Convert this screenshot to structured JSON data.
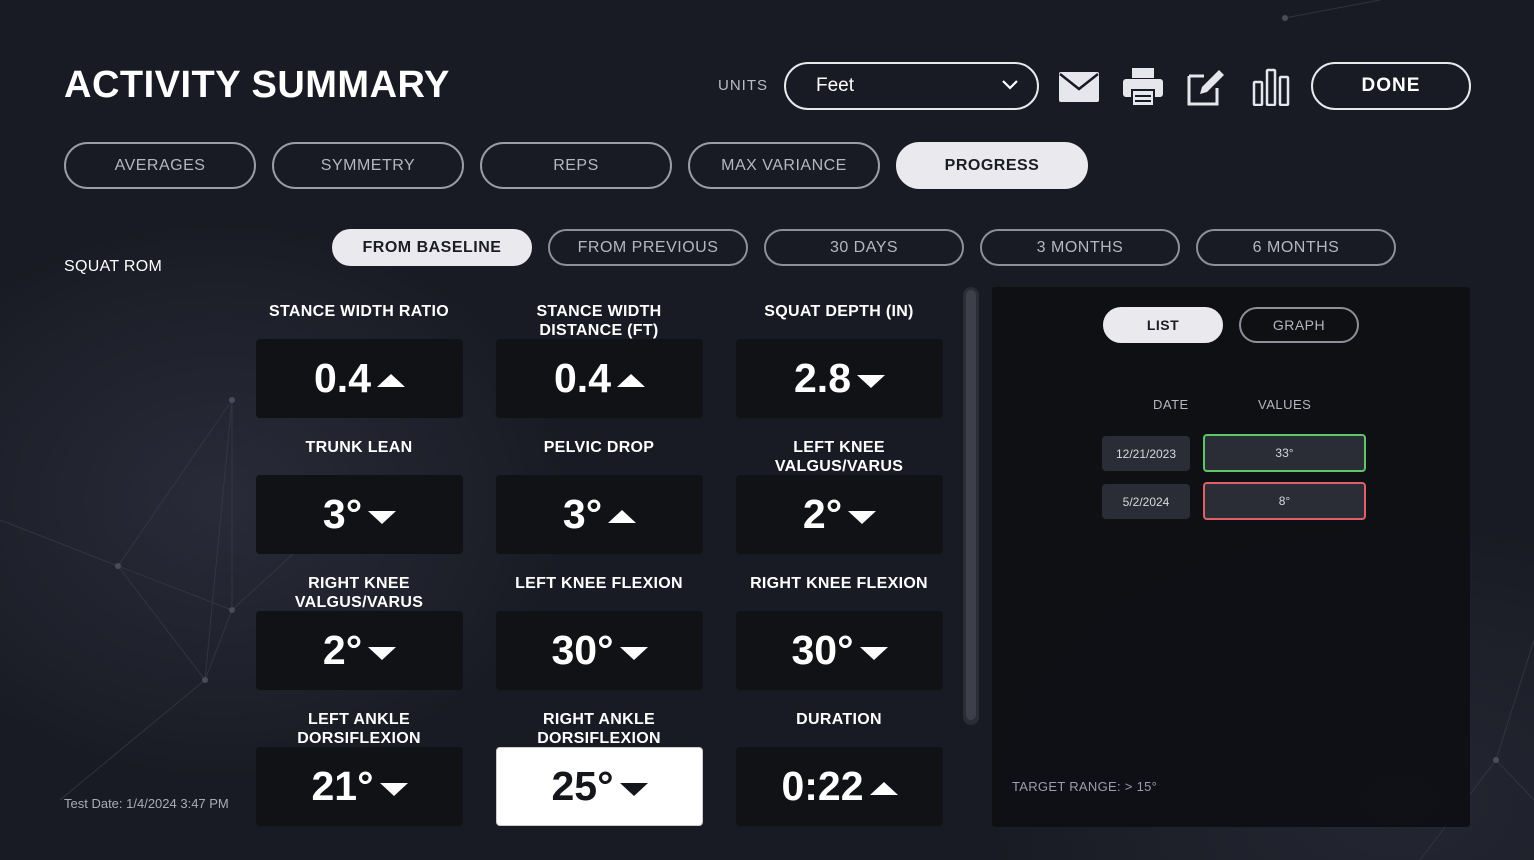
{
  "header": {
    "title": "ACTIVITY SUMMARY",
    "units_label": "UNITS",
    "units_value": "Feet",
    "done_label": "DONE"
  },
  "tabs": [
    {
      "label": "AVERAGES",
      "active": false
    },
    {
      "label": "SYMMETRY",
      "active": false
    },
    {
      "label": "REPS",
      "active": false
    },
    {
      "label": "MAX VARIANCE",
      "active": false
    },
    {
      "label": "PROGRESS",
      "active": true
    }
  ],
  "section_label": "SQUAT ROM",
  "ranges": [
    {
      "label": "FROM BASELINE",
      "active": true
    },
    {
      "label": "FROM PREVIOUS",
      "active": false
    },
    {
      "label": "30 DAYS",
      "active": false
    },
    {
      "label": "3 MONTHS",
      "active": false
    },
    {
      "label": "6 MONTHS",
      "active": false
    }
  ],
  "metrics": [
    {
      "label": "STANCE WIDTH RATIO",
      "value": "0.4",
      "trend": "up"
    },
    {
      "label": "STANCE WIDTH DISTANCE (FT)",
      "value": "0.4",
      "trend": "up"
    },
    {
      "label": "SQUAT DEPTH (IN)",
      "value": "2.8",
      "trend": "down"
    },
    {
      "label": "TRUNK LEAN",
      "value": "3°",
      "trend": "down"
    },
    {
      "label": "PELVIC DROP",
      "value": "3°",
      "trend": "up"
    },
    {
      "label": "LEFT KNEE VALGUS/VARUS",
      "value": "2°",
      "trend": "down"
    },
    {
      "label": "RIGHT KNEE VALGUS/VARUS",
      "value": "2°",
      "trend": "down"
    },
    {
      "label": "LEFT KNEE FLEXION",
      "value": "30°",
      "trend": "down"
    },
    {
      "label": "RIGHT KNEE FLEXION",
      "value": "30°",
      "trend": "down"
    },
    {
      "label": "LEFT ANKLE DORSIFLEXION",
      "value": "21°",
      "trend": "down"
    },
    {
      "label": "RIGHT ANKLE DORSIFLEXION",
      "value": "25°",
      "trend": "down",
      "selected": true
    },
    {
      "label": "DURATION",
      "value": "0:22",
      "trend": "up"
    }
  ],
  "test_date": "Test Date: 1/4/2024 3:47 PM",
  "panel": {
    "list_label": "LIST",
    "graph_label": "GRAPH",
    "date_header": "DATE",
    "values_header": "VALUES",
    "rows": [
      {
        "date": "12/21/2023",
        "value": "33°",
        "status": "good"
      },
      {
        "date": "5/2/2024",
        "value": "8°",
        "status": "bad"
      }
    ],
    "target_range": "TARGET RANGE: > 15°"
  },
  "colors": {
    "good": "#5fc46a",
    "bad": "#e0606a",
    "accent": "#e9e9ee"
  }
}
